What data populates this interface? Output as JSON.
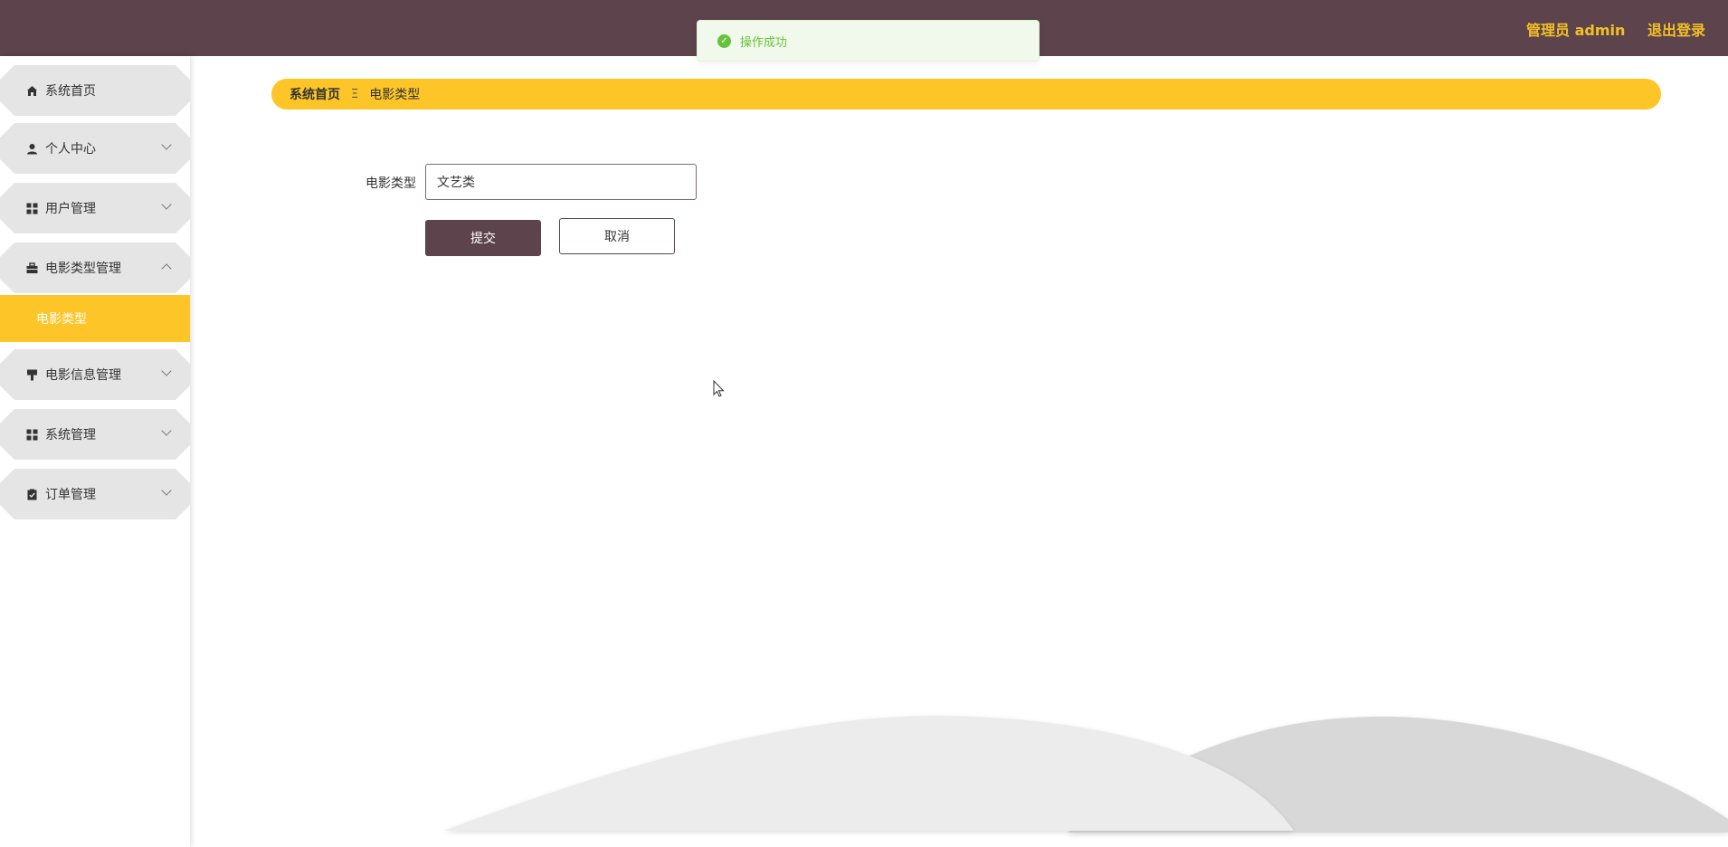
{
  "header": {
    "user_label": "管理员 admin",
    "logout_label": "退出登录",
    "bg_color": "#5c434c",
    "accent_color": "#f4c026"
  },
  "toast": {
    "message": "操作成功",
    "icon": "check-circle-icon"
  },
  "sidebar": {
    "items": [
      {
        "label": "系统首页",
        "icon": "home-icon"
      },
      {
        "label": "个人中心",
        "icon": "user-icon"
      },
      {
        "label": "用户管理",
        "icon": "grid-icon"
      },
      {
        "label": "电影类型管理",
        "icon": "briefcase-icon"
      },
      {
        "label": "电影信息管理",
        "icon": "brush-icon"
      },
      {
        "label": "系统管理",
        "icon": "grid-icon"
      },
      {
        "label": "订单管理",
        "icon": "clipboard-check-icon"
      }
    ],
    "active_sub_item": "电影类型",
    "active_color": "#fdc527"
  },
  "breadcrumb": {
    "home": "系统首页",
    "separator": "Ξ",
    "current": "电影类型"
  },
  "form": {
    "field_label": "电影类型",
    "field_value": "文艺类",
    "submit_label": "提交",
    "cancel_label": "取消"
  }
}
